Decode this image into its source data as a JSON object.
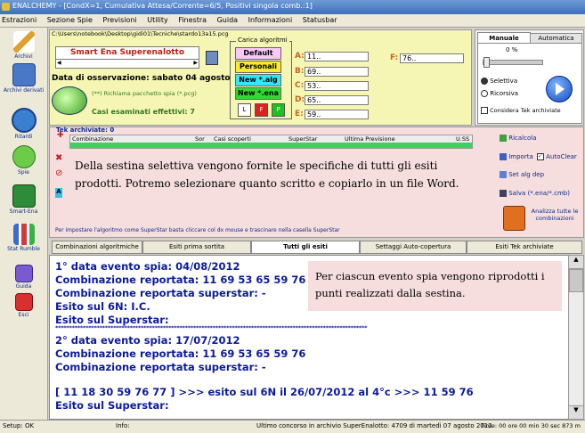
{
  "window": {
    "title": "ENALCHEMY - [CondX=1, Cumulativa Attesa/Corrente=6/5, Positivi singola comb.:1]"
  },
  "menu": [
    "Estrazioni",
    "Sezione Spie",
    "Previsioni",
    "Utility",
    "Finestra",
    "Guida",
    "Informazioni",
    "Statusbar"
  ],
  "sidebar": {
    "items": [
      {
        "label": "Archivi",
        "icon": "pencil-icon"
      },
      {
        "label": "Archivi derivati",
        "icon": "computer-icon"
      },
      {
        "label": "Ritardi",
        "icon": "clock-icon"
      },
      {
        "label": "Spie",
        "icon": "spy-icon"
      },
      {
        "label": "Smart-Ena",
        "icon": "chip-icon"
      },
      {
        "label": "Stat Rumble",
        "icon": "chart-icon"
      },
      {
        "label": "Guida",
        "icon": "book-icon"
      },
      {
        "label": "Esci",
        "icon": "exit-icon"
      }
    ]
  },
  "top": {
    "path": "C:\\Users\\notebook\\Desktop\\gidi01\\Tecniche\\stardo13a15.pcg",
    "game": "Smart Ena Superenalotto",
    "date": "Data di osservazione:  sabato 04 agosto 2012",
    "richiama": "(**) Richiama pacchetto spia (*.pcg)",
    "casi": "Casi esaminati effettivi: 7",
    "carica_label": "Carica algoritmi",
    "buttons": [
      "Default",
      "Personali",
      "New *.alg",
      "New *.ena"
    ],
    "lfp": [
      "L",
      "F",
      "P"
    ],
    "selects": [
      {
        "label": "A:",
        "value": "11.."
      },
      {
        "label": "B:",
        "value": "69.."
      },
      {
        "label": "C:",
        "value": "53.."
      },
      {
        "label": "D:",
        "value": "65.."
      },
      {
        "label": "E:",
        "value": "59.."
      }
    ],
    "f_select": {
      "label": "F:",
      "value": "76.."
    }
  },
  "right_panel": {
    "tabs": [
      "Manuale",
      "Automatica"
    ],
    "percent": "0 %",
    "radio_selettiva": "Selettiva",
    "radio_ricorsiva": "Ricorsiva",
    "considera": "Considera Tek archiviate"
  },
  "tek": {
    "caption": "Tek archiviate: 0",
    "columns": [
      "Combinazione",
      "Sor",
      "Casi scoperti",
      "SuperStar",
      "Ultima Previsione",
      "U.SS"
    ],
    "hint": "Per impostare l'algoritmo come SuperStar basta cliccare col dx mouse e trascinare nella casella SuperStar",
    "annotation": "Della sestina selettiva vengono fornite le specifiche di tutti gli esiti prodotti. Potremo selezionare quanto scritto e copiarlo in un file Word.",
    "side": {
      "ricalcola": "Ricalcola",
      "importa": "Importa",
      "autoclear": "AutoClear",
      "set_alg": "Set alg dep",
      "salva": "Salva (*.ena/*.cmb)",
      "analizza": "Analizza tutte le combinazioni"
    }
  },
  "tabs": [
    "Combinazioni algoritmiche",
    "Esiti prima sortita",
    "Tutti gli esiti",
    "Settaggi Auto-copertura",
    "Esiti Tek archiviate"
  ],
  "results": {
    "lines": [
      "1° data evento spia: 04/08/2012",
      "Combinazione reportata: 11 69 53 65 59 76",
      "Combinazione reportata superstar: -",
      "Esito sul 6N: I.C.",
      "Esito sul Superstar:",
      "*****************************************************************************************************************",
      "2° data evento spia: 17/07/2012",
      "Combinazione reportata: 11 69 53 65 59 76",
      "Combinazione reportata superstar: -",
      "",
      "[ 11 18 30 59 76 77 ] >>> esito sul 6N il 26/07/2012 al 4°c  >>> 11 59 76",
      "Esito sul Superstar:"
    ],
    "annotation": "Per ciascun evento spia vengono riprodotti i punti realizzati dalla sestina."
  },
  "status": {
    "setup": "Setup: OK",
    "info": "Info:",
    "ultimo": "Ultimo concorso in archivio SuperEnalotto: 4709 di martedì 07 agosto 2012",
    "time": "Time: 00 ore 00 min 30 sec 873 m"
  }
}
